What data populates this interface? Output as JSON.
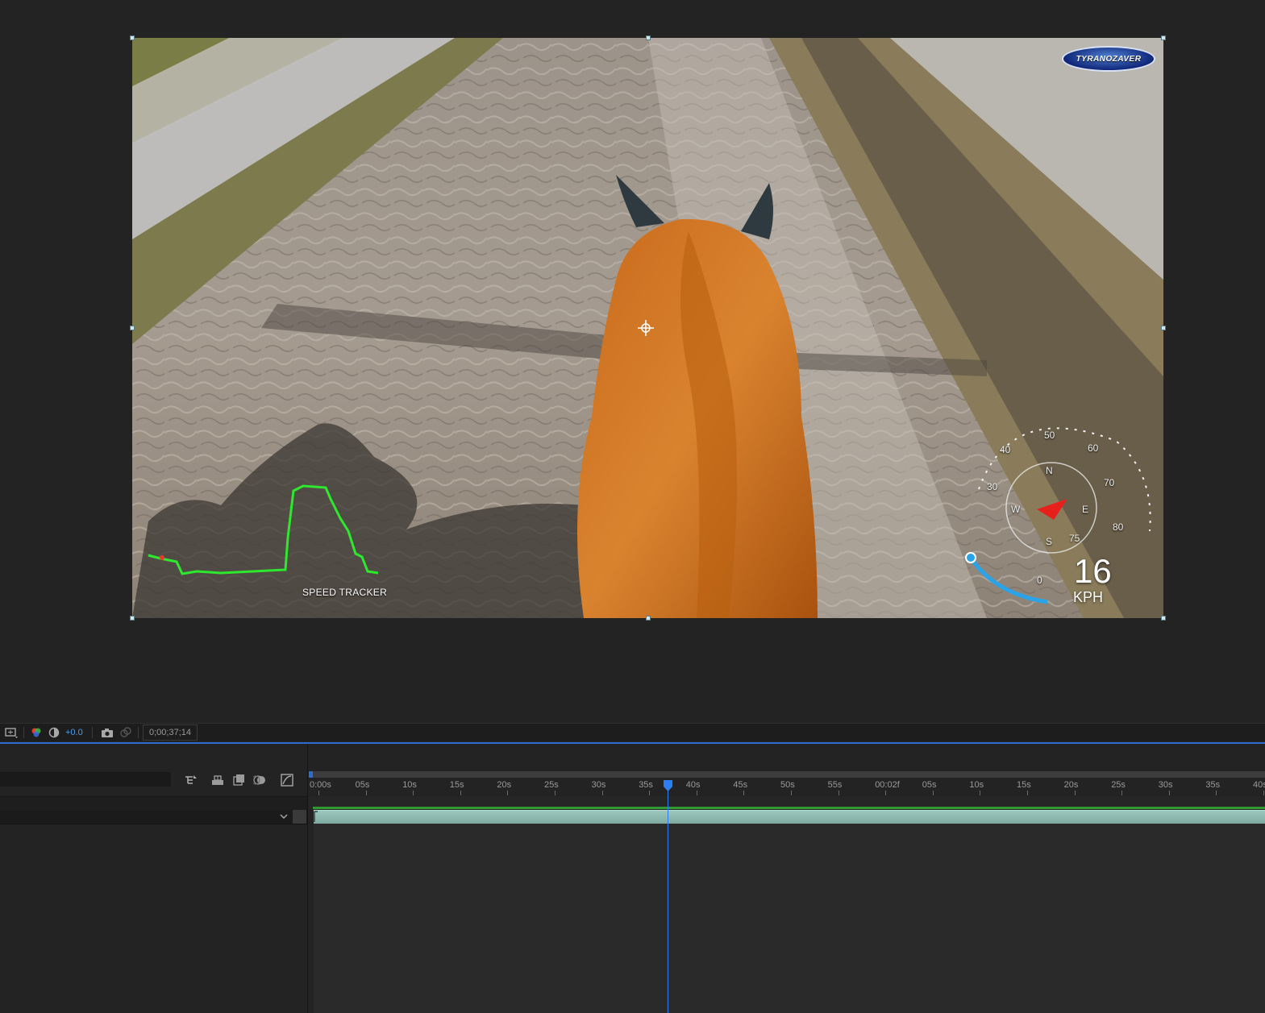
{
  "viewer": {
    "logo_text": "TYRANOZAVER",
    "speed_tracker_label": "SPEED TRACKER",
    "speedometer": {
      "value": "16",
      "unit": "KPH",
      "scale_labels": [
        "0",
        "30",
        "40",
        "50",
        "60",
        "70",
        "80",
        "75"
      ],
      "compass": [
        "N",
        "E",
        "S",
        "W"
      ]
    }
  },
  "toolbar": {
    "exposure_value": "+0.0",
    "timecode": "0;00;37;14"
  },
  "timeline": {
    "search_placeholder": "",
    "ruler_ticks": [
      "0:00s",
      "05s",
      "10s",
      "15s",
      "20s",
      "25s",
      "30s",
      "35s",
      "40s",
      "45s",
      "50s",
      "55s",
      "00:02f",
      "05s",
      "10s",
      "15s",
      "20s",
      "25s",
      "30s",
      "35s",
      "40s"
    ]
  },
  "colors": {
    "accent": "#2d7ef0",
    "cache_green": "#2f9a2f",
    "layer_bar": "#8db8ae",
    "speed_graph": "#2ee82e",
    "gauge_arc": "#2aa3e8"
  }
}
